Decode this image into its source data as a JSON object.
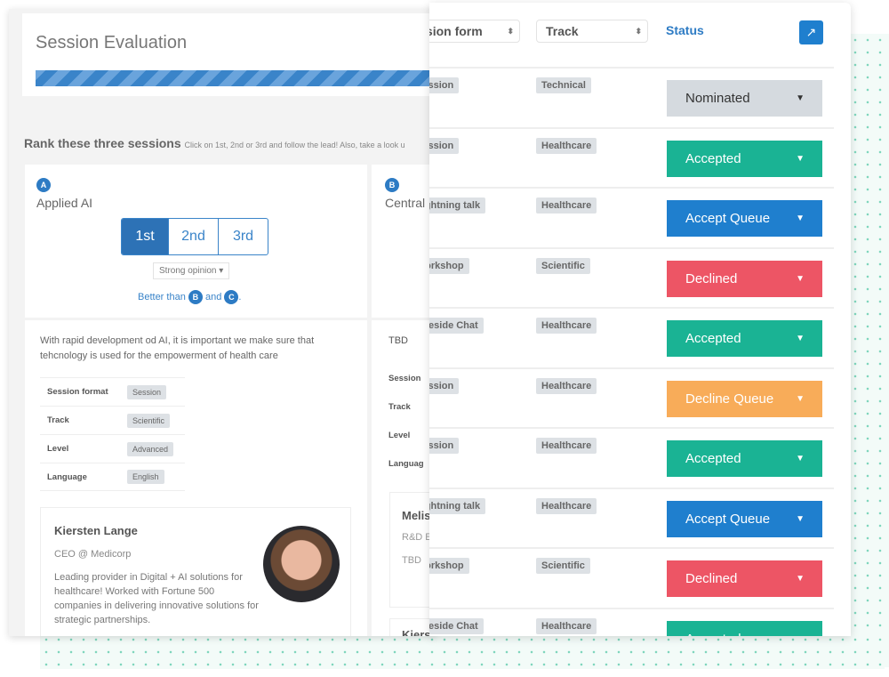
{
  "evaluation": {
    "title": "Session Evaluation",
    "progress_percent": 100
  },
  "rank": {
    "heading": "Rank these three sessions",
    "hint": "Click on 1st, 2nd or 3rd and follow the lead! Also, take a look u"
  },
  "session_a": {
    "badge": "A",
    "title": "Applied AI",
    "rank_buttons": [
      "1st",
      "2nd",
      "3rd"
    ],
    "selected_rank": "1st",
    "opinion": "Strong opinion ▾",
    "better_prefix": "Better than",
    "better_b": "B",
    "better_and": "and",
    "better_c": "C",
    "better_suffix": ".",
    "description": "With rapid development od AI, it is important we make sure that tehcnology is used for the empowerment of health care",
    "meta": [
      {
        "label": "Session format",
        "value": "Session"
      },
      {
        "label": "Track",
        "value": "Scientific"
      },
      {
        "label": "Level",
        "value": "Advanced"
      },
      {
        "label": "Language",
        "value": "English"
      }
    ],
    "speaker": {
      "name": "Kiersten Lange",
      "title": "CEO @ Medicorp",
      "bio": "Leading provider in Digital + AI solutions for healthcare! Worked with Fortune 500 companies in delivering innovative solutions for strategic partnerships."
    }
  },
  "session_b": {
    "badge": "B",
    "title": "Central",
    "description": "TBD",
    "meta_labels": [
      "Session",
      "Track",
      "Level",
      "Languag"
    ],
    "speaker1_name": "Melis",
    "speaker1_title": "R&D E",
    "speaker1_bio": "TBD",
    "speaker2_name": "Kiers"
  },
  "table": {
    "col_session_form": "Session form",
    "col_track": "Track",
    "col_status": "Status",
    "sort_icon": "⬍",
    "rows": [
      {
        "format": "Session",
        "track": "Technical",
        "status": "Nominated"
      },
      {
        "format": "Session",
        "track": "Healthcare",
        "status": "Accepted"
      },
      {
        "format": "Lightning talk",
        "track": "Healthcare",
        "status": "Accept Queue"
      },
      {
        "format": "Workshop",
        "track": "Scientific",
        "status": "Declined"
      },
      {
        "format": "Fireside Chat",
        "track": "Healthcare",
        "status": "Accepted"
      },
      {
        "format": "Session",
        "track": "Healthcare",
        "status": "Decline Queue"
      },
      {
        "format": "Session",
        "track": "Healthcare",
        "status": "Accepted"
      },
      {
        "format": "Lightning talk",
        "track": "Healthcare",
        "status": "Accept Queue"
      },
      {
        "format": "Workshop",
        "track": "Scientific",
        "status": "Declined"
      },
      {
        "format": "Fireside Chat",
        "track": "Healthcare",
        "status": "Accepted"
      }
    ]
  },
  "status_colors": {
    "Nominated": "#d5dadf",
    "Accepted": "#1ab394",
    "Accept Queue": "#1f7fce",
    "Declined": "#ed5565",
    "Decline Queue": "#f8ac59"
  }
}
